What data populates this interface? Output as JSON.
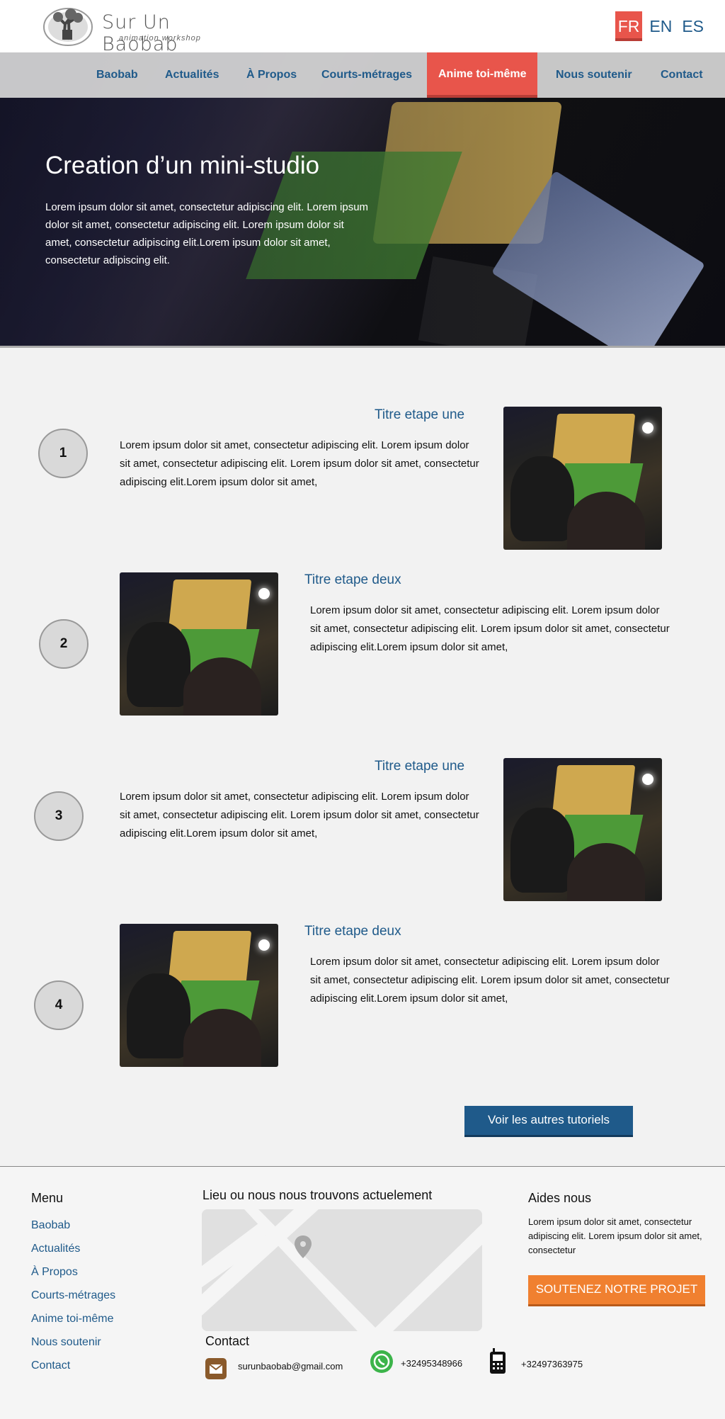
{
  "header": {
    "logo_title": "Sur Un Baobab",
    "logo_subtitle": "animation workshop",
    "languages": [
      "FR",
      "EN",
      "ES"
    ]
  },
  "nav": {
    "items": [
      "Baobab",
      "Actualités",
      "À Propos",
      "Courts-métrages",
      "Anime toi-même",
      "Nous soutenir",
      "Contact"
    ],
    "active": "Anime toi-même"
  },
  "hero": {
    "title": "Creation d’un mini-studio",
    "text": "Lorem ipsum dolor sit amet, consectetur adipiscing elit. Lorem ipsum dolor sit amet, consectetur adipiscing elit. Lorem ipsum dolor sit amet, consectetur adipiscing elit.Lorem ipsum dolor sit amet, consectetur adipiscing elit."
  },
  "steps": [
    {
      "number": "1",
      "title": "Titre etape une",
      "text": "Lorem ipsum dolor sit amet, consectetur adipiscing elit. Lorem ipsum dolor sit amet, consectetur adipiscing elit. Lorem ipsum dolor sit amet, consectetur adipiscing elit.Lorem ipsum dolor sit amet,"
    },
    {
      "number": "2",
      "title": "Titre etape deux",
      "text": "Lorem ipsum dolor sit amet, consectetur adipiscing elit. Lorem ipsum dolor sit amet, consectetur adipiscing elit. Lorem ipsum dolor sit amet, consectetur adipiscing elit.Lorem ipsum dolor sit amet,"
    },
    {
      "number": "3",
      "title": "Titre etape une",
      "text": "Lorem ipsum dolor sit amet, consectetur adipiscing elit. Lorem ipsum dolor sit amet, consectetur adipiscing elit. Lorem ipsum dolor sit amet, consectetur adipiscing elit.Lorem ipsum dolor sit amet,"
    },
    {
      "number": "4",
      "title": "Titre etape deux",
      "text": "Lorem ipsum dolor sit amet, consectetur adipiscing elit. Lorem ipsum dolor sit amet, consectetur adipiscing elit. Lorem ipsum dolor sit amet, consectetur adipiscing elit.Lorem ipsum dolor sit amet,"
    }
  ],
  "more_button": "Voir les autres tutoriels",
  "footer": {
    "menu_title": "Menu",
    "menu_items": [
      "Baobab",
      "Actualités",
      "À Propos",
      "Courts-métrages",
      "Anime toi-même",
      "Nous soutenir",
      "Contact"
    ],
    "location_title": "Lieu ou nous nous trouvons actuelement",
    "help_title": "Aides nous",
    "help_text": "Lorem ipsum dolor sit amet, consectetur adipiscing elit. Lorem ipsum dolor sit amet, consectetur",
    "support_button": "SOUTENEZ NOTRE PROJET",
    "contact_title": "Contact",
    "email": "surunbaobab@gmail.com",
    "whatsapp": "+32495348966",
    "phone": "+32497363975"
  },
  "colors": {
    "accent_red": "#e8554b",
    "link_blue": "#1f5a8a",
    "support_orange": "#f08030"
  },
  "icons": [
    "baobab-logo-icon",
    "map-pin-icon",
    "envelope-icon",
    "whatsapp-icon",
    "mobile-phone-icon"
  ]
}
